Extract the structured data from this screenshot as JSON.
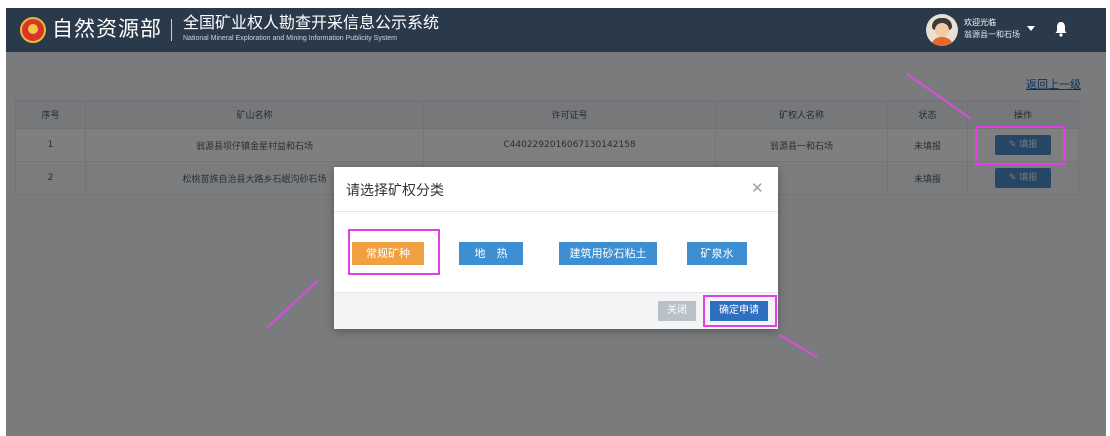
{
  "header": {
    "ministry": "自然资源部",
    "system_title": "全国矿业权人勘查开采信息公示系统",
    "system_subtitle": "National Mineral Exploration and Mining Information Publicity System",
    "user_welcome": "欢迎光临",
    "user_org": "翁源县一和石场",
    "icons": [
      "national-emblem-icon",
      "user-avatar-icon",
      "dropdown-caret-icon",
      "bell-icon"
    ]
  },
  "nav": {
    "back_link": "返回上一级"
  },
  "table": {
    "headers": [
      "序号",
      "矿山名称",
      "许可证号",
      "矿权人名称",
      "状态",
      "操作"
    ],
    "rows": [
      {
        "index": "1",
        "mine": "翁源县坝仔镇金星村益和石场",
        "license": "C4402292016067130142158",
        "owner": "翁源县一和石场",
        "status": "未填报",
        "action": "填报"
      },
      {
        "index": "2",
        "mine": "松桃苗族自治县大路乡石岷沟砂石场",
        "license": "",
        "owner": "",
        "status": "未填报",
        "action": "填报"
      }
    ]
  },
  "modal": {
    "title": "请选择矿权分类",
    "options": [
      "常规矿种",
      "地　热",
      "建筑用砂石粘土",
      "矿泉水"
    ],
    "selected_option": "常规矿种",
    "cancel_label": "关闭",
    "confirm_label": "确定申请"
  },
  "colors": {
    "header_bg": "#2b3a4b",
    "accent_blue": "#3d8fd1",
    "selected_orange": "#f0a040",
    "confirm_blue": "#2f6fc0",
    "annotation_magenta": "#e040e8"
  }
}
